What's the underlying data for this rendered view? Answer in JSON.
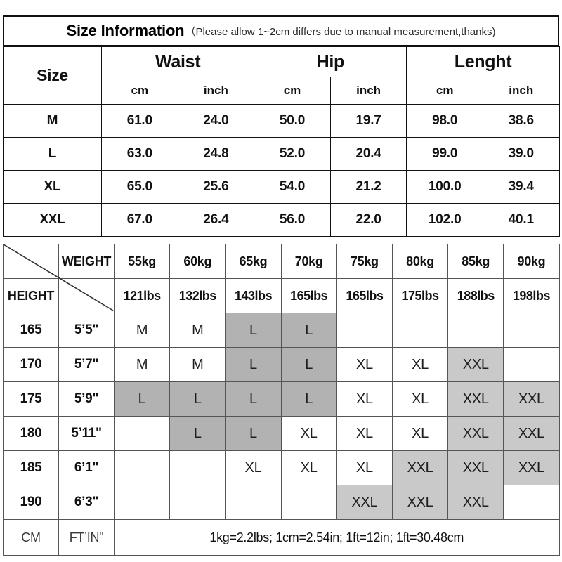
{
  "title": {
    "main": "Size Information",
    "note": "（Please allow 1~2cm differs due to manual measurement,thanks)"
  },
  "size_table": {
    "size_header": "Size",
    "groups": [
      "Waist",
      "Hip",
      "Lenght"
    ],
    "units": [
      "cm",
      "inch",
      "cm",
      "inch",
      "cm",
      "inch"
    ],
    "rows": [
      {
        "size": "M",
        "cells": [
          "61.0",
          "24.0",
          "50.0",
          "19.7",
          "98.0",
          "38.6"
        ]
      },
      {
        "size": "L",
        "cells": [
          "63.0",
          "24.8",
          "52.0",
          "20.4",
          "99.0",
          "39.0"
        ]
      },
      {
        "size": "XL",
        "cells": [
          "65.0",
          "25.6",
          "54.0",
          "21.2",
          "100.0",
          "39.4"
        ]
      },
      {
        "size": "XXL",
        "cells": [
          "67.0",
          "26.4",
          "56.0",
          "22.0",
          "102.0",
          "40.1"
        ]
      }
    ]
  },
  "matrix_table": {
    "corner_weight_label": "WEIGHT",
    "corner_height_label": "HEIGHT",
    "weights_kg": [
      "55kg",
      "60kg",
      "65kg",
      "70kg",
      "75kg",
      "80kg",
      "85kg",
      "90kg"
    ],
    "weights_lbs": [
      "121lbs",
      "132lbs",
      "143lbs",
      "165lbs",
      "165lbs",
      "175lbs",
      "188lbs",
      "198lbs"
    ],
    "rows": [
      {
        "cm": "165",
        "ft": "5’5\"",
        "cells": [
          "M",
          "M",
          "L",
          "L",
          "",
          "",
          "",
          ""
        ]
      },
      {
        "cm": "170",
        "ft": "5’7\"",
        "cells": [
          "M",
          "M",
          "L",
          "L",
          "XL",
          "XL",
          "XXL",
          ""
        ]
      },
      {
        "cm": "175",
        "ft": "5’9\"",
        "cells": [
          "L",
          "L",
          "L",
          "L",
          "XL",
          "XL",
          "XXL",
          "XXL"
        ]
      },
      {
        "cm": "180",
        "ft": "5’11\"",
        "cells": [
          "",
          "L",
          "L",
          "XL",
          "XL",
          "XL",
          "XXL",
          "XXL"
        ]
      },
      {
        "cm": "185",
        "ft": "6’1\"",
        "cells": [
          "",
          "",
          "XL",
          "XL",
          "XL",
          "XXL",
          "XXL",
          "XXL"
        ]
      },
      {
        "cm": "190",
        "ft": "6’3\"",
        "cells": [
          "",
          "",
          "",
          "",
          "XXL",
          "XXL",
          "XXL",
          ""
        ]
      }
    ],
    "footer": {
      "unit_cm": "CM",
      "unit_ft": "FT’IN\"",
      "conversion": "1kg=2.2lbs; 1cm=2.54in; 1ft=12in; 1ft=30.48cm"
    }
  },
  "colors": {
    "fill_L": "#b2b2b2",
    "fill_XXL": "#c9c9c9",
    "border": "#111111",
    "grid": "#555555"
  }
}
